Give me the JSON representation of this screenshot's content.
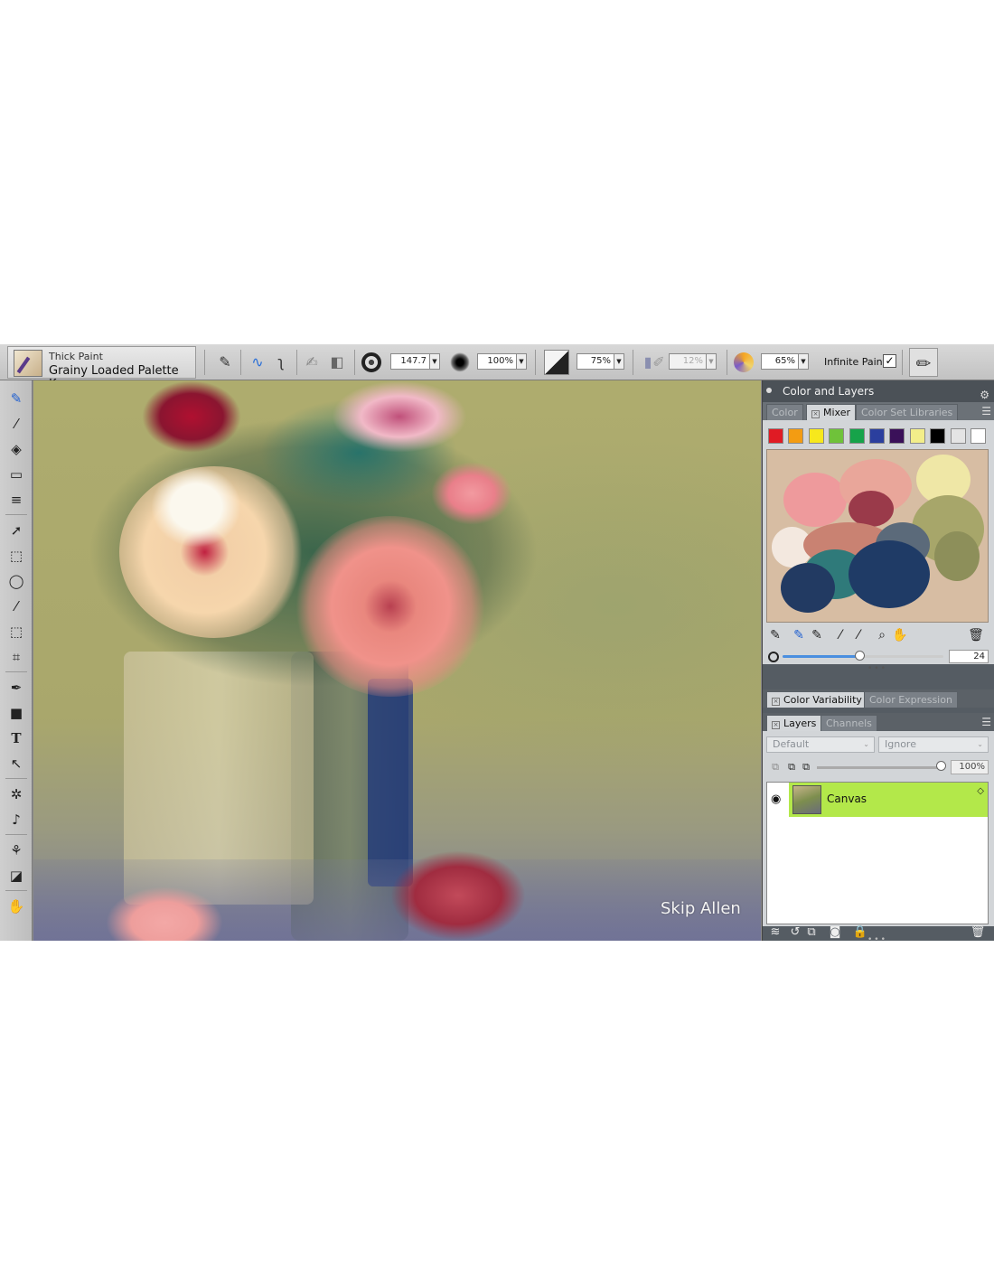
{
  "propbar": {
    "brush_category": "Thick Paint",
    "brush_variant": "Grainy Loaded Palette K...",
    "size_value": "147.7",
    "opacity_value": "100%",
    "grain_value": "75%",
    "resat_value": "12%",
    "bleed_value": "65%",
    "infinite_paint_label": "Infinite Paint",
    "infinite_paint_checked": "✓"
  },
  "canvas": {
    "signature": "Skip Allen"
  },
  "color_panel": {
    "title": "Color and Layers",
    "tabs": [
      "Color",
      "Mixer",
      "Color Set Libraries"
    ],
    "swatches": [
      "#e01b24",
      "#f39c12",
      "#f7e81c",
      "#6fc23a",
      "#16a34a",
      "#2b3f9e",
      "#3a1059",
      "#f3ee8a",
      "#000000",
      "#e4e4e4",
      "#ffffff"
    ],
    "mixer_size_value": "24",
    "sub_tabs": [
      "Color Variability",
      "Color Expression"
    ]
  },
  "layers_panel": {
    "tabs": [
      "Layers",
      "Channels"
    ],
    "composite_method": "Default",
    "preserve": "Ignore",
    "opacity_value": "100%",
    "layers": [
      {
        "name": "Canvas",
        "selected": true
      }
    ]
  }
}
